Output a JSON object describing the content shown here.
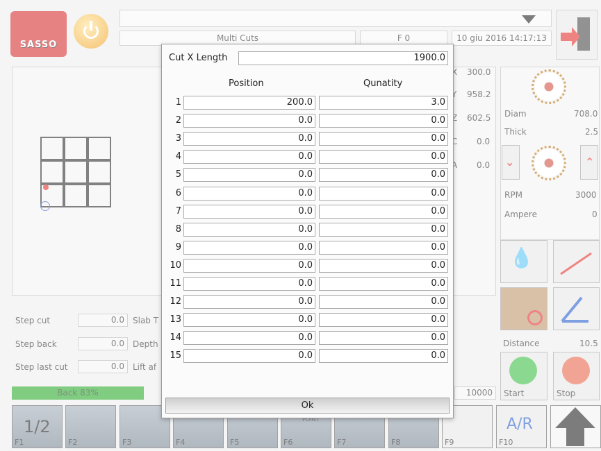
{
  "header": {
    "logo_text": "SASSO",
    "program_name": "Multi Cuts",
    "field_code": "F 0",
    "datetime": "10 giu 2016 14:17:13"
  },
  "axes": [
    {
      "label": "X",
      "value": "300.0"
    },
    {
      "label": "Y",
      "value": "958.2"
    },
    {
      "label": "Z",
      "value": "602.5"
    },
    {
      "label": "C",
      "value": "0.0"
    },
    {
      "label": "A",
      "value": "0.0"
    }
  ],
  "blade": {
    "diam_label": "Diam",
    "diam_value": "708.0",
    "thick_label": "Thick",
    "thick_value": "2.5",
    "rpm_label": "RPM",
    "rpm_value": "3000",
    "ampere_label": "Ampere",
    "ampere_value": "0",
    "distance_label": "Distance",
    "distance_value": "10.5"
  },
  "params": {
    "step_cut_label": "Step cut",
    "step_cut_value": "0.0",
    "step_back_label": "Step back",
    "step_back_value": "0.0",
    "step_last_label": "Step last cut",
    "step_last_value": "0.0",
    "slab_label": "Slab T",
    "depth_label": "Depth",
    "lift_label": "Lift af"
  },
  "status": {
    "back_bar_text": "Back 83%",
    "back_progress": 0.83,
    "speed_value": "10000"
  },
  "controls": {
    "start_label": "Start",
    "stop_label": "Stop"
  },
  "fkeys": [
    "F1",
    "F2",
    "F3",
    "F4",
    "F5",
    "F6",
    "F7",
    "F8",
    "F9",
    "F10"
  ],
  "fkey_texts": {
    "f1_overlay": "1/2",
    "f6_overlay": "START POINT",
    "f10_overlay": "A/R"
  },
  "dialog": {
    "cut_length_label": "Cut X Length",
    "cut_length_value": "1900.0",
    "col_position": "Position",
    "col_quantity": "Qunatity",
    "ok_label": "Ok",
    "rows": [
      {
        "n": "1",
        "position": "200.0",
        "quantity": "3.0"
      },
      {
        "n": "2",
        "position": "0.0",
        "quantity": "0.0"
      },
      {
        "n": "3",
        "position": "0.0",
        "quantity": "0.0"
      },
      {
        "n": "4",
        "position": "0.0",
        "quantity": "0.0"
      },
      {
        "n": "5",
        "position": "0.0",
        "quantity": "0.0"
      },
      {
        "n": "6",
        "position": "0.0",
        "quantity": "0.0"
      },
      {
        "n": "7",
        "position": "0.0",
        "quantity": "0.0"
      },
      {
        "n": "8",
        "position": "0.0",
        "quantity": "0.0"
      },
      {
        "n": "9",
        "position": "0.0",
        "quantity": "0.0"
      },
      {
        "n": "10",
        "position": "0.0",
        "quantity": "0.0"
      },
      {
        "n": "11",
        "position": "0.0",
        "quantity": "0.0"
      },
      {
        "n": "12",
        "position": "0.0",
        "quantity": "0.0"
      },
      {
        "n": "13",
        "position": "0.0",
        "quantity": "0.0"
      },
      {
        "n": "14",
        "position": "0.0",
        "quantity": "0.0"
      },
      {
        "n": "15",
        "position": "0.0",
        "quantity": "0.0"
      }
    ]
  },
  "colors": {
    "brand_red": "#d21c1c",
    "progress_green": "#19a31a",
    "accent_red": "#e0201b"
  }
}
